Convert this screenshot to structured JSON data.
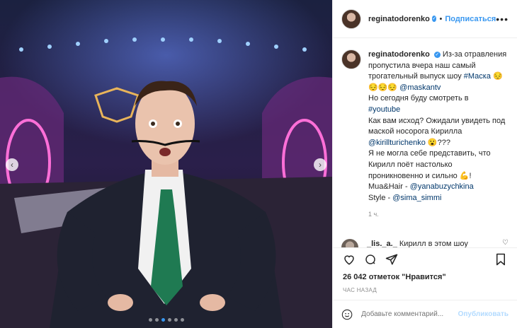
{
  "post": {
    "username": "reginatodorenko",
    "verified": "✓",
    "separator": "•",
    "follow_label": "Подписаться",
    "more_label": "•••",
    "caption": {
      "username": "reginatodorenko",
      "line1": "Из-за отравления пропустила вчера наш самый трогательный выпуск шоу ",
      "hashtag_mask": "#Маска",
      "emojis1": "😔😔😔😔",
      "mention_maskantv": "@maskantv",
      "line2": "Но сегодня буду смотреть в ",
      "hashtag_youtube": "#youtube",
      "line3": "Как вам исход? Ожидали увидеть под маской носорога Кирилла ",
      "mention_kirill": "@kirillturichenko",
      "emojis2": "😮???",
      "line4": "Я не могла себе представить, что Кирилл поёт настолько проникновенно и сильно ",
      "emoji3": "💪",
      "excl": "!",
      "line5": "Mua&Hair - ",
      "mention_yana": "@yanabuzychkina",
      "line6": "Style - ",
      "mention_sima": "@sima_simmi",
      "time": "1 ч."
    },
    "comment": {
      "username": "_lis._a._",
      "text": "Кирилл в этом шоу влюбил в себя заново, я шокирована,какой он"
    },
    "likes_text": "26 042 отметок \"Нравится\"",
    "posted_ago": "ЧАС НАЗАД",
    "add_comment": {
      "placeholder": "Добавьте комментарий...",
      "publish_label": "Опубликовать"
    },
    "carousel": {
      "total": 6,
      "active_index": 2
    }
  },
  "colors": {
    "accent": "#3897f0",
    "link": "#00376b",
    "muted": "#8e8e8e"
  }
}
